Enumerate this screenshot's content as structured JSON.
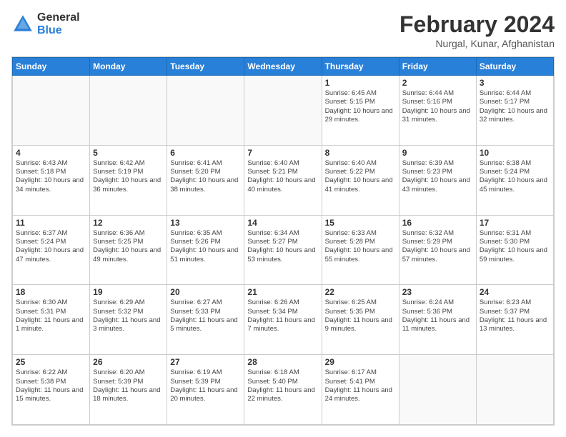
{
  "header": {
    "logo": {
      "general": "General",
      "blue": "Blue"
    },
    "title": "February 2024",
    "location": "Nurgal, Kunar, Afghanistan"
  },
  "calendar": {
    "days_of_week": [
      "Sunday",
      "Monday",
      "Tuesday",
      "Wednesday",
      "Thursday",
      "Friday",
      "Saturday"
    ],
    "weeks": [
      [
        {
          "day": "",
          "info": ""
        },
        {
          "day": "",
          "info": ""
        },
        {
          "day": "",
          "info": ""
        },
        {
          "day": "",
          "info": ""
        },
        {
          "day": "1",
          "info": "Sunrise: 6:45 AM\nSunset: 5:15 PM\nDaylight: 10 hours and 29 minutes."
        },
        {
          "day": "2",
          "info": "Sunrise: 6:44 AM\nSunset: 5:16 PM\nDaylight: 10 hours and 31 minutes."
        },
        {
          "day": "3",
          "info": "Sunrise: 6:44 AM\nSunset: 5:17 PM\nDaylight: 10 hours and 32 minutes."
        }
      ],
      [
        {
          "day": "4",
          "info": "Sunrise: 6:43 AM\nSunset: 5:18 PM\nDaylight: 10 hours and 34 minutes."
        },
        {
          "day": "5",
          "info": "Sunrise: 6:42 AM\nSunset: 5:19 PM\nDaylight: 10 hours and 36 minutes."
        },
        {
          "day": "6",
          "info": "Sunrise: 6:41 AM\nSunset: 5:20 PM\nDaylight: 10 hours and 38 minutes."
        },
        {
          "day": "7",
          "info": "Sunrise: 6:40 AM\nSunset: 5:21 PM\nDaylight: 10 hours and 40 minutes."
        },
        {
          "day": "8",
          "info": "Sunrise: 6:40 AM\nSunset: 5:22 PM\nDaylight: 10 hours and 41 minutes."
        },
        {
          "day": "9",
          "info": "Sunrise: 6:39 AM\nSunset: 5:23 PM\nDaylight: 10 hours and 43 minutes."
        },
        {
          "day": "10",
          "info": "Sunrise: 6:38 AM\nSunset: 5:24 PM\nDaylight: 10 hours and 45 minutes."
        }
      ],
      [
        {
          "day": "11",
          "info": "Sunrise: 6:37 AM\nSunset: 5:24 PM\nDaylight: 10 hours and 47 minutes."
        },
        {
          "day": "12",
          "info": "Sunrise: 6:36 AM\nSunset: 5:25 PM\nDaylight: 10 hours and 49 minutes."
        },
        {
          "day": "13",
          "info": "Sunrise: 6:35 AM\nSunset: 5:26 PM\nDaylight: 10 hours and 51 minutes."
        },
        {
          "day": "14",
          "info": "Sunrise: 6:34 AM\nSunset: 5:27 PM\nDaylight: 10 hours and 53 minutes."
        },
        {
          "day": "15",
          "info": "Sunrise: 6:33 AM\nSunset: 5:28 PM\nDaylight: 10 hours and 55 minutes."
        },
        {
          "day": "16",
          "info": "Sunrise: 6:32 AM\nSunset: 5:29 PM\nDaylight: 10 hours and 57 minutes."
        },
        {
          "day": "17",
          "info": "Sunrise: 6:31 AM\nSunset: 5:30 PM\nDaylight: 10 hours and 59 minutes."
        }
      ],
      [
        {
          "day": "18",
          "info": "Sunrise: 6:30 AM\nSunset: 5:31 PM\nDaylight: 11 hours and 1 minute."
        },
        {
          "day": "19",
          "info": "Sunrise: 6:29 AM\nSunset: 5:32 PM\nDaylight: 11 hours and 3 minutes."
        },
        {
          "day": "20",
          "info": "Sunrise: 6:27 AM\nSunset: 5:33 PM\nDaylight: 11 hours and 5 minutes."
        },
        {
          "day": "21",
          "info": "Sunrise: 6:26 AM\nSunset: 5:34 PM\nDaylight: 11 hours and 7 minutes."
        },
        {
          "day": "22",
          "info": "Sunrise: 6:25 AM\nSunset: 5:35 PM\nDaylight: 11 hours and 9 minutes."
        },
        {
          "day": "23",
          "info": "Sunrise: 6:24 AM\nSunset: 5:36 PM\nDaylight: 11 hours and 11 minutes."
        },
        {
          "day": "24",
          "info": "Sunrise: 6:23 AM\nSunset: 5:37 PM\nDaylight: 11 hours and 13 minutes."
        }
      ],
      [
        {
          "day": "25",
          "info": "Sunrise: 6:22 AM\nSunset: 5:38 PM\nDaylight: 11 hours and 15 minutes."
        },
        {
          "day": "26",
          "info": "Sunrise: 6:20 AM\nSunset: 5:39 PM\nDaylight: 11 hours and 18 minutes."
        },
        {
          "day": "27",
          "info": "Sunrise: 6:19 AM\nSunset: 5:39 PM\nDaylight: 11 hours and 20 minutes."
        },
        {
          "day": "28",
          "info": "Sunrise: 6:18 AM\nSunset: 5:40 PM\nDaylight: 11 hours and 22 minutes."
        },
        {
          "day": "29",
          "info": "Sunrise: 6:17 AM\nSunset: 5:41 PM\nDaylight: 11 hours and 24 minutes."
        },
        {
          "day": "",
          "info": ""
        },
        {
          "day": "",
          "info": ""
        }
      ]
    ]
  }
}
